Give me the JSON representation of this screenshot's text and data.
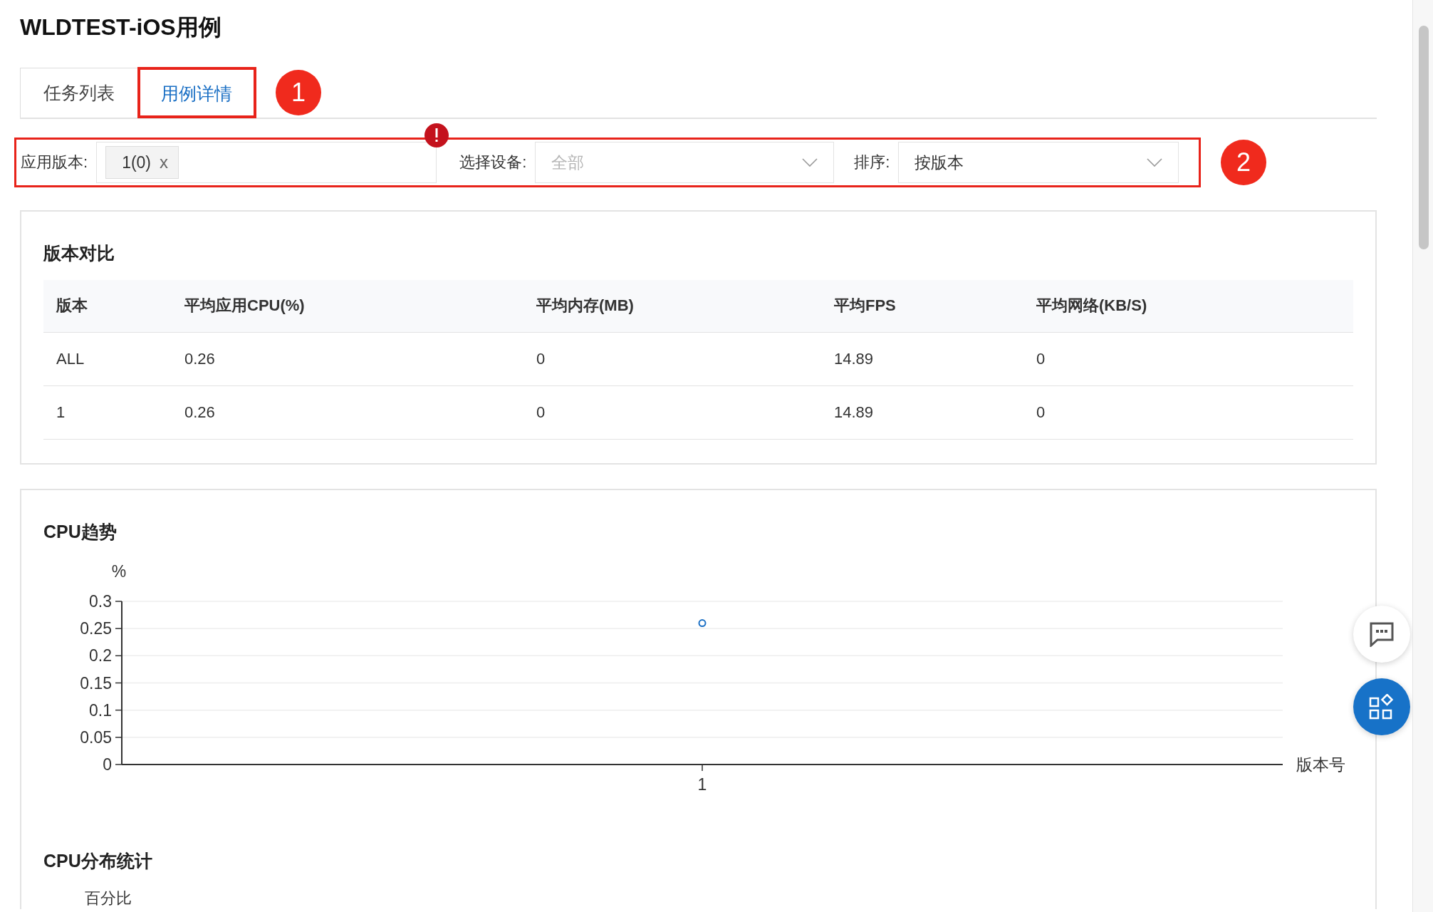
{
  "page_title": "WLDTEST-iOS用例",
  "tabs": {
    "marker": "1",
    "items": [
      {
        "label": "任务列表",
        "selected": false,
        "highlighted": false
      },
      {
        "label": "用例详情",
        "selected": true,
        "highlighted": true
      }
    ]
  },
  "filters": {
    "highlighted": true,
    "marker": "2",
    "error": true,
    "version": {
      "label": "应用版本:",
      "tags": [
        {
          "label": "1(0)",
          "remove": "x"
        }
      ]
    },
    "device": {
      "label": "选择设备:",
      "placeholder": "全部"
    },
    "sort": {
      "label": "排序:",
      "value": "按版本"
    }
  },
  "version_compare": {
    "title": "版本对比",
    "columns": [
      "版本",
      "平均应用CPU(%)",
      "平均内存(MB)",
      "平均FPS",
      "平均网络(KB/S)"
    ],
    "rows": [
      [
        "ALL",
        "0.26",
        "0",
        "14.89",
        "0"
      ],
      [
        "1",
        "0.26",
        "0",
        "14.89",
        "0"
      ]
    ]
  },
  "cpu_trend": {
    "title": "CPU趋势",
    "chart_data": {
      "type": "line",
      "ylabel": "%",
      "xlabel": "版本号",
      "categories": [
        "1"
      ],
      "grid": true,
      "series": [
        {
          "color": "#1a6fc4",
          "marker": true,
          "values": [
            0.26
          ]
        }
      ],
      "ylim": [
        0,
        0.3
      ],
      "yticks": [
        0,
        0.05,
        0.1,
        0.15,
        0.2,
        0.25,
        0.3
      ]
    }
  },
  "cpu_distribution": {
    "title": "CPU分布统计",
    "axis_label": "百分比"
  }
}
